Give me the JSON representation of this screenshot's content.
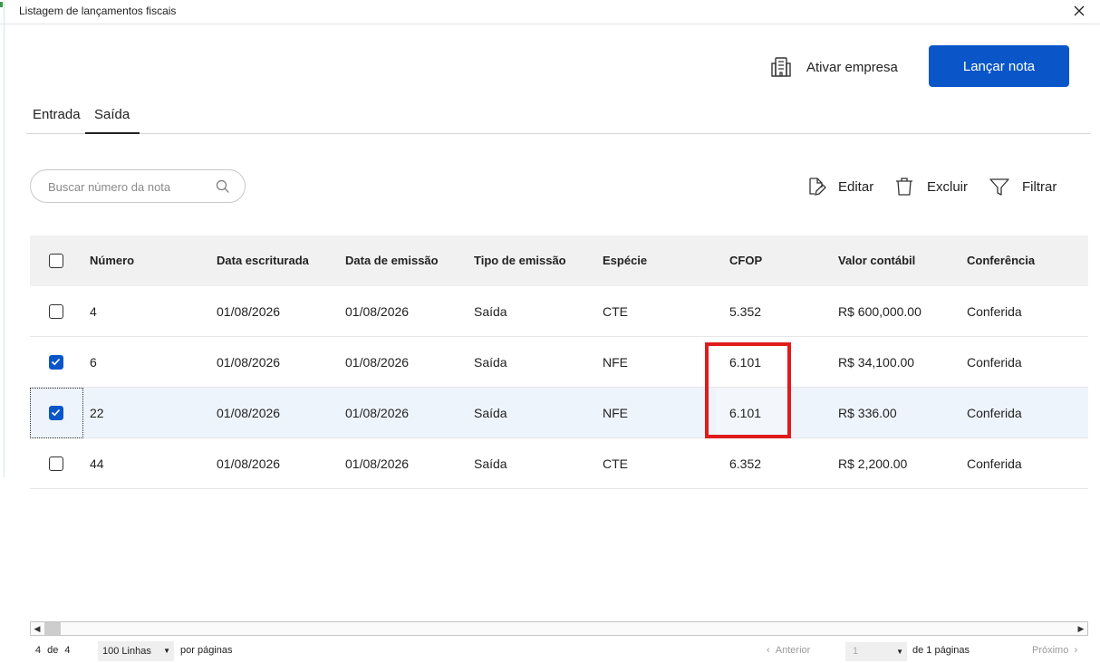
{
  "window": {
    "title": "Listagem de lançamentos fiscais"
  },
  "header": {
    "ativar_label": "Ativar empresa",
    "lancar_label": "Lançar nota"
  },
  "tabs": [
    {
      "label": "Entrada",
      "active": false
    },
    {
      "label": "Saída",
      "active": true
    }
  ],
  "search": {
    "placeholder": "Buscar número da nota",
    "value": ""
  },
  "actions": {
    "edit_label": "Editar",
    "delete_label": "Excluir",
    "filter_label": "Filtrar"
  },
  "table": {
    "columns": [
      "Número",
      "Data escriturada",
      "Data de emissão",
      "Tipo de emissão",
      "Espécie",
      "CFOP",
      "Valor contábil",
      "Conferência"
    ],
    "rows": [
      {
        "numero": "4",
        "data_escriturada": "01/08/2026",
        "data_emissao": "01/08/2026",
        "tipo": "Saída",
        "especie": "CTE",
        "cfop": "5.352",
        "valor": "R$ 600,000.00",
        "conferencia": "Conferida",
        "checked": false
      },
      {
        "numero": "6",
        "data_escriturada": "01/08/2026",
        "data_emissao": "01/08/2026",
        "tipo": "Saída",
        "especie": "NFE",
        "cfop": "6.101",
        "valor": "R$ 34,100.00",
        "conferencia": "Conferida",
        "checked": true
      },
      {
        "numero": "22",
        "data_escriturada": "01/08/2026",
        "data_emissao": "01/08/2026",
        "tipo": "Saída",
        "especie": "NFE",
        "cfop": "6.101",
        "valor": "R$ 336.00",
        "conferencia": "Conferida",
        "checked": true
      },
      {
        "numero": "44",
        "data_escriturada": "01/08/2026",
        "data_emissao": "01/08/2026",
        "tipo": "Saída",
        "especie": "CTE",
        "cfop": "6.352",
        "valor": "R$ 2,200.00",
        "conferencia": "Conferida",
        "checked": false
      }
    ]
  },
  "pagination": {
    "shown": "4",
    "of_label": "de",
    "total": "4",
    "rows_per_page": "100 Linhas",
    "per_page_label": "por páginas",
    "prev_label": "Anterior",
    "current_page": "1",
    "pages_label": "de 1 páginas",
    "next_label": "Próximo"
  },
  "icons": {
    "close": "close-icon",
    "building": "building-icon",
    "search": "search-icon",
    "edit": "edit-document-icon",
    "delete": "trash-icon",
    "filter": "filter-icon"
  },
  "colors": {
    "primary": "#0a56c9",
    "highlight": "#e01b1b",
    "selected_row": "#eef4fc"
  }
}
